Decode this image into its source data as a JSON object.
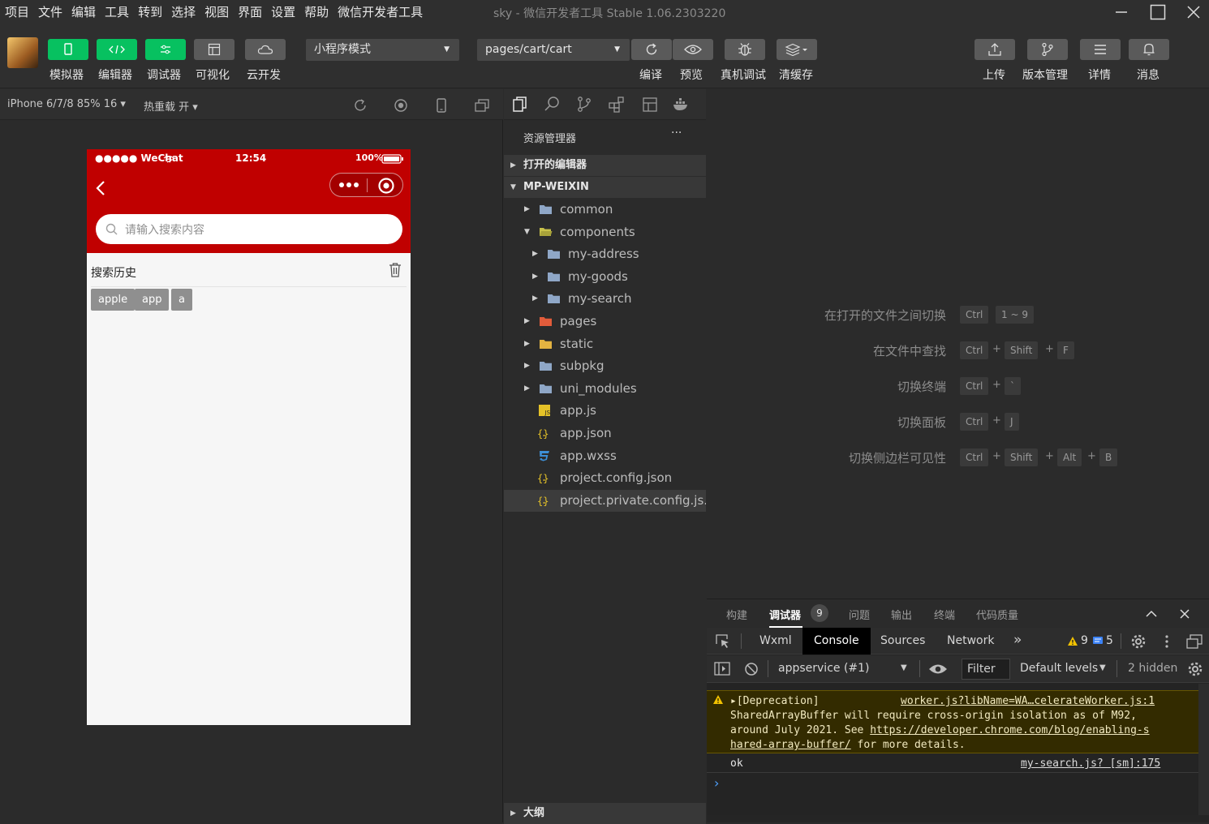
{
  "menu": {
    "items": [
      "项目",
      "文件",
      "编辑",
      "工具",
      "转到",
      "选择",
      "视图",
      "界面",
      "设置",
      "帮助",
      "微信开发者工具"
    ],
    "window_title": "sky - 微信开发者工具 Stable 1.06.2303220"
  },
  "toolbar": {
    "left_buttons": [
      {
        "label": "模拟器",
        "icon": "phone-icon"
      },
      {
        "label": "编辑器",
        "icon": "code-icon"
      },
      {
        "label": "调试器",
        "icon": "debug-icon"
      },
      {
        "label": "可视化",
        "icon": "layout-icon"
      },
      {
        "label": "云开发",
        "icon": "cloud-icon"
      }
    ],
    "mode_select": "小程序模式",
    "page_select": "pages/cart/cart",
    "mid_buttons": [
      {
        "label": "编译",
        "icon": "refresh-icon"
      },
      {
        "label": "预览",
        "icon": "eye-icon"
      },
      {
        "label": "真机调试",
        "icon": "bug-icon"
      },
      {
        "label": "清缓存",
        "icon": "layers-icon"
      }
    ],
    "right_buttons": [
      {
        "label": "上传",
        "icon": "upload-icon"
      },
      {
        "label": "版本管理",
        "icon": "branch-icon"
      },
      {
        "label": "详情",
        "icon": "menu-icon"
      },
      {
        "label": "消息",
        "icon": "bell-icon"
      }
    ]
  },
  "simbar": {
    "device": "iPhone 6/7/8 85% 16 ▾",
    "hot_reload": "热重载 开 ▾"
  },
  "phone": {
    "carrier": "●●●●● WeChat",
    "time": "12:54",
    "battery": "100%",
    "search_placeholder": "请输入搜索内容",
    "history_title": "搜索历史",
    "history_tags": [
      "apple",
      "app",
      "a"
    ]
  },
  "explorer": {
    "title": "资源管理器",
    "more": "···",
    "section_open": "打开的编辑器",
    "section_project": "MP-WEIXIN",
    "section_outline": "大纲",
    "tree": [
      {
        "name": "common",
        "type": "folder",
        "depth": 0,
        "expanded": false,
        "color": "#8fa7c7"
      },
      {
        "name": "components",
        "type": "folder-open",
        "depth": 0,
        "expanded": true,
        "color": "#c7c04a"
      },
      {
        "name": "my-address",
        "type": "folder",
        "depth": 1,
        "expanded": false,
        "color": "#8fa7c7"
      },
      {
        "name": "my-goods",
        "type": "folder",
        "depth": 1,
        "expanded": false,
        "color": "#8fa7c7"
      },
      {
        "name": "my-search",
        "type": "folder",
        "depth": 1,
        "expanded": false,
        "color": "#8fa7c7"
      },
      {
        "name": "pages",
        "type": "folder-pages",
        "depth": 0,
        "expanded": false,
        "color": "#e25c3b"
      },
      {
        "name": "static",
        "type": "folder-static",
        "depth": 0,
        "expanded": false,
        "color": "#e3b341"
      },
      {
        "name": "subpkg",
        "type": "folder",
        "depth": 0,
        "expanded": false,
        "color": "#8fa7c7"
      },
      {
        "name": "uni_modules",
        "type": "folder",
        "depth": 0,
        "expanded": false,
        "color": "#8fa7c7"
      },
      {
        "name": "app.js",
        "type": "js",
        "depth": 0,
        "color": "#e5c228"
      },
      {
        "name": "app.json",
        "type": "json",
        "depth": 0,
        "color": "#e5c228"
      },
      {
        "name": "app.wxss",
        "type": "css",
        "depth": 0,
        "color": "#3d8fd6"
      },
      {
        "name": "project.config.json",
        "type": "json",
        "depth": 0,
        "color": "#e5c228"
      },
      {
        "name": "project.private.config.js...",
        "type": "json",
        "depth": 0,
        "color": "#e5c228",
        "selected": true
      }
    ]
  },
  "shortcuts": [
    {
      "label": "在打开的文件之间切换",
      "keys": [
        "Ctrl",
        "1 ~ 9"
      ],
      "plus": false
    },
    {
      "label": "在文件中查找",
      "keys": [
        "Ctrl",
        "Shift",
        "F"
      ],
      "plus": true
    },
    {
      "label": "切换终端",
      "keys": [
        "Ctrl",
        "`"
      ],
      "plus": true
    },
    {
      "label": "切换面板",
      "keys": [
        "Ctrl",
        "J"
      ],
      "plus": true
    },
    {
      "label": "切换侧边栏可见性",
      "keys": [
        "Ctrl",
        "Shift",
        "Alt",
        "B"
      ],
      "plus": true
    }
  ],
  "debugger": {
    "tabs": [
      "构建",
      "调试器",
      "问题",
      "输出",
      "终端",
      "代码质量"
    ],
    "active_tab": "调试器",
    "badge": "9",
    "devtools_tabs": [
      "Wxml",
      "Console",
      "Sources",
      "Network"
    ],
    "active_devtool": "Console",
    "more_tabs": "»",
    "warn_count": "9",
    "info_count": "5",
    "context": "appservice (#1)",
    "filter": "Filter",
    "levels": "Default levels",
    "hidden": "2 hidden",
    "warning": {
      "title": "▸[Deprecation]",
      "source": "worker.js?libName=WA…celerateWorker.js:1",
      "line1": "SharedArrayBuffer will require cross-origin isolation as of M92,",
      "line2a": "around July 2021. See ",
      "line2b": "https://developer.chrome.com/blog/enabling-s",
      "line3a": "hared-array-buffer/",
      "line3b": " for more details."
    },
    "log": {
      "text": "ok",
      "source": "my-search.js? [sm]:175"
    },
    "prompt": "›"
  }
}
